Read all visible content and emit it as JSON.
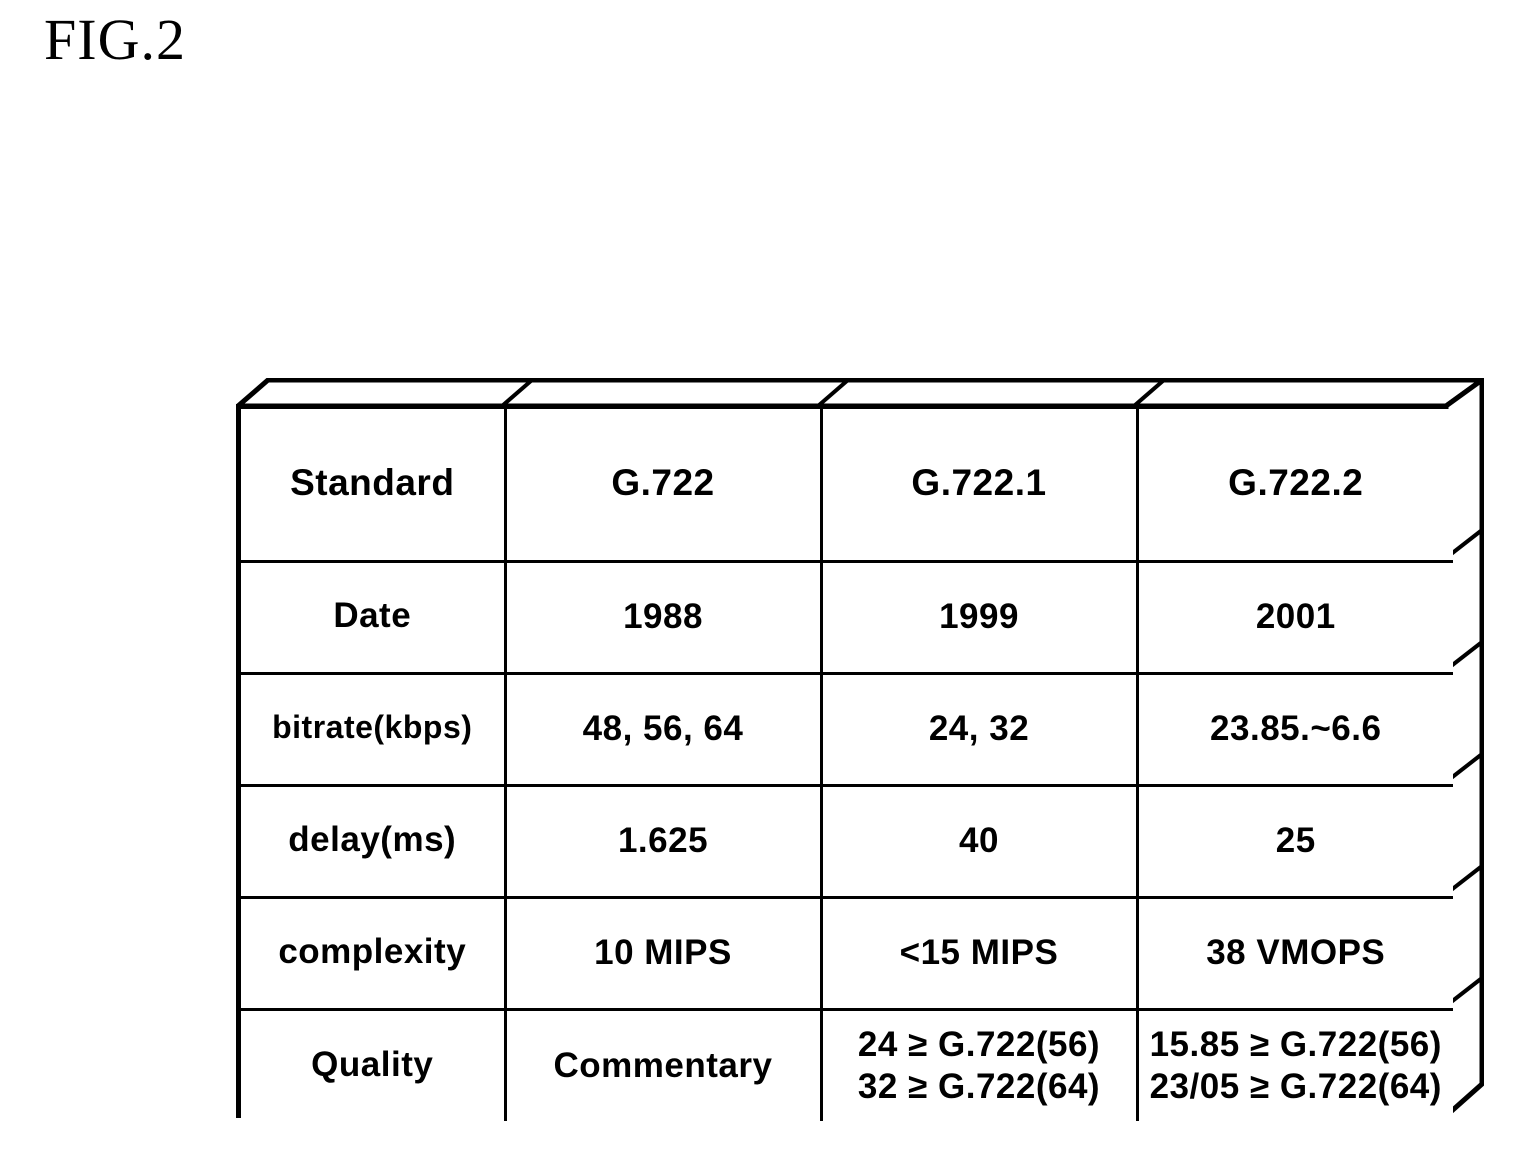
{
  "figure": {
    "title": "FIG.2"
  },
  "table": {
    "row_labels": [
      "Standard",
      "Date",
      "bitrate(kbps)",
      "delay(ms)",
      "complexity",
      "Quality"
    ],
    "columns": [
      "G.722",
      "G.722.1",
      "G.722.2"
    ],
    "rows": [
      {
        "label": "Date",
        "values": [
          "1988",
          "1999",
          "2001"
        ]
      },
      {
        "label": "bitrate(kbps)",
        "values": [
          "48, 56, 64",
          "24, 32",
          "23.85.~6.6"
        ]
      },
      {
        "label": "delay(ms)",
        "values": [
          "1.625",
          "40",
          "25"
        ]
      },
      {
        "label": "complexity",
        "values": [
          "10 MIPS",
          "<15 MIPS",
          "38 VMOPS"
        ]
      }
    ],
    "quality_row": {
      "label": "Quality",
      "g722": "Commentary",
      "g7221_line1": "24 ≥ G.722(56)",
      "g7221_line2": "32 ≥ G.722(64)",
      "g7222_line1": "15.85 ≥ G.722(56)",
      "g7222_line2": "23/05 ≥ G.722(64)"
    }
  },
  "style": {
    "ink": "#000000",
    "paper": "#ffffff"
  }
}
